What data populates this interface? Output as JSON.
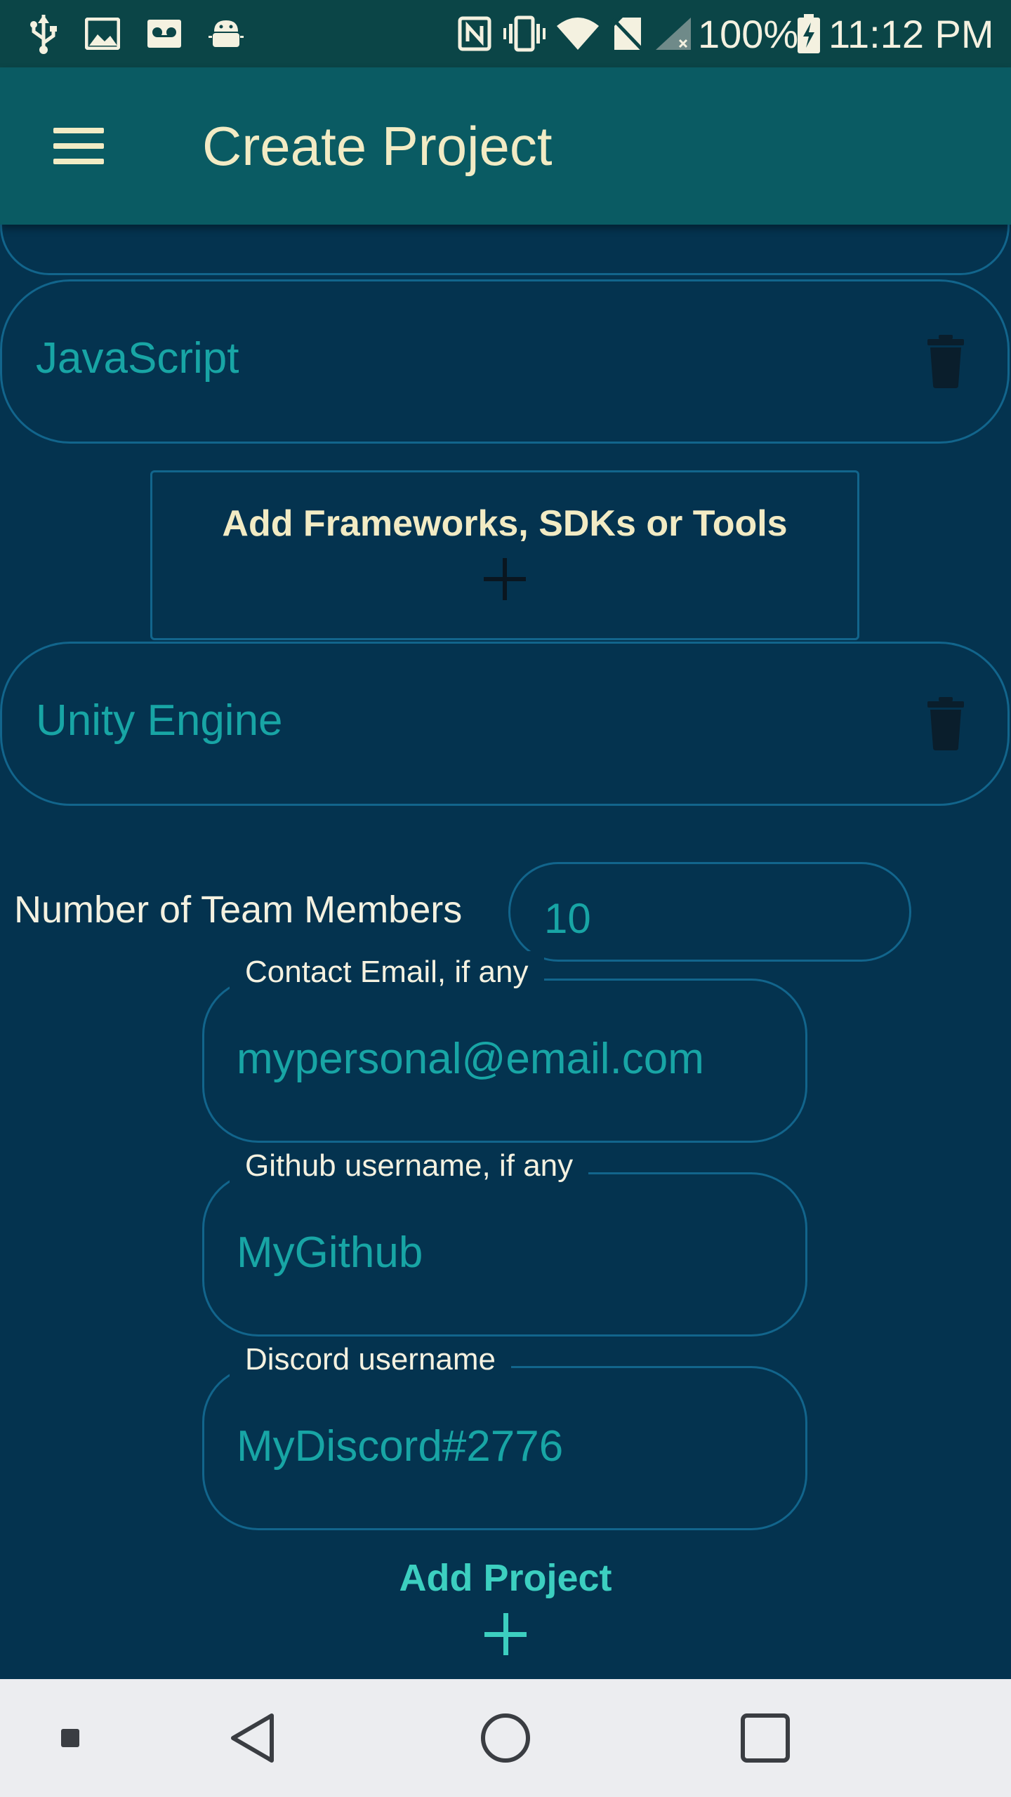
{
  "status_bar": {
    "battery": "100%",
    "time": "11:12 PM",
    "icons": [
      "usb-icon",
      "image-icon",
      "voicemail-icon",
      "android-debug-icon",
      "nfc-icon",
      "vibrate-icon",
      "wifi-icon",
      "no-sim-icon",
      "signal-icon",
      "battery-charging-icon"
    ]
  },
  "app_bar": {
    "title": "Create Project",
    "menu_icon": "hamburger-menu-icon"
  },
  "languages": [
    {
      "label": "JavaScript",
      "delete_icon": "trash-icon"
    }
  ],
  "add_frameworks_label": "Add Frameworks, SDKs or Tools",
  "frameworks": [
    {
      "label": "Unity Engine",
      "delete_icon": "trash-icon"
    }
  ],
  "team": {
    "label": "Number of Team Members",
    "value": "10"
  },
  "fields": {
    "email": {
      "label": "Contact Email, if any",
      "value": "mypersonal@email.com"
    },
    "github": {
      "label": "Github username, if any",
      "value": "MyGithub"
    },
    "discord": {
      "label": "Discord username",
      "value": "MyDiscord#2776"
    }
  },
  "add_project_label": "Add Project",
  "colors": {
    "background": "#04334F",
    "app_bar": "#0A5B63",
    "status_bar": "#0B4547",
    "accent_text": "#18A5A5",
    "title_text": "#F2EBC4",
    "border": "#12658C",
    "add_project": "#3CCFC0"
  },
  "nav_bar": {
    "icons": [
      "recent-dot-icon",
      "back-icon",
      "home-icon",
      "overview-icon"
    ]
  }
}
